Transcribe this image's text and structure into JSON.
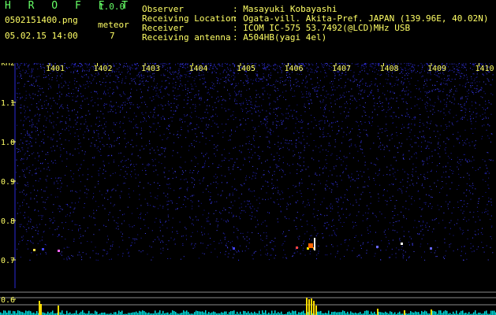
{
  "app": {
    "title": "H R O F F T",
    "version": "1.0.0"
  },
  "file": {
    "name": "0502151400.png",
    "datetime": "05.02.15 14:00"
  },
  "meteor": {
    "label": "meteor",
    "count": "7"
  },
  "info": [
    {
      "label": "Observer",
      "value": ": Masayuki Kobayashi"
    },
    {
      "label": "Receiving Location",
      "value": ": Ogata-vill. Akita-Pref. JAPAN (139.96E, 40.02N)"
    },
    {
      "label": "Receiver",
      "value": ": ICOM IC-575 53.7492(@LCD)MHz USB"
    },
    {
      "label": "Receiving antenna",
      "value": ": A504HB(yagi 4el)"
    }
  ],
  "axis": {
    "y_unit": "kHz",
    "y_ticks": [
      "1.1",
      "1.0",
      "0.9",
      "0.8",
      "0.7",
      "0.6"
    ],
    "x_ticks": [
      "1401",
      "1402",
      "1403",
      "1404",
      "1405",
      "1406",
      "1407",
      "1408",
      "1409",
      "1410"
    ]
  },
  "colors": {
    "text_yellow": "#ffff66",
    "text_green": "#66ff66",
    "noise_blue": "#2a2ad8",
    "trace_cyan": "#00e0e0"
  }
}
